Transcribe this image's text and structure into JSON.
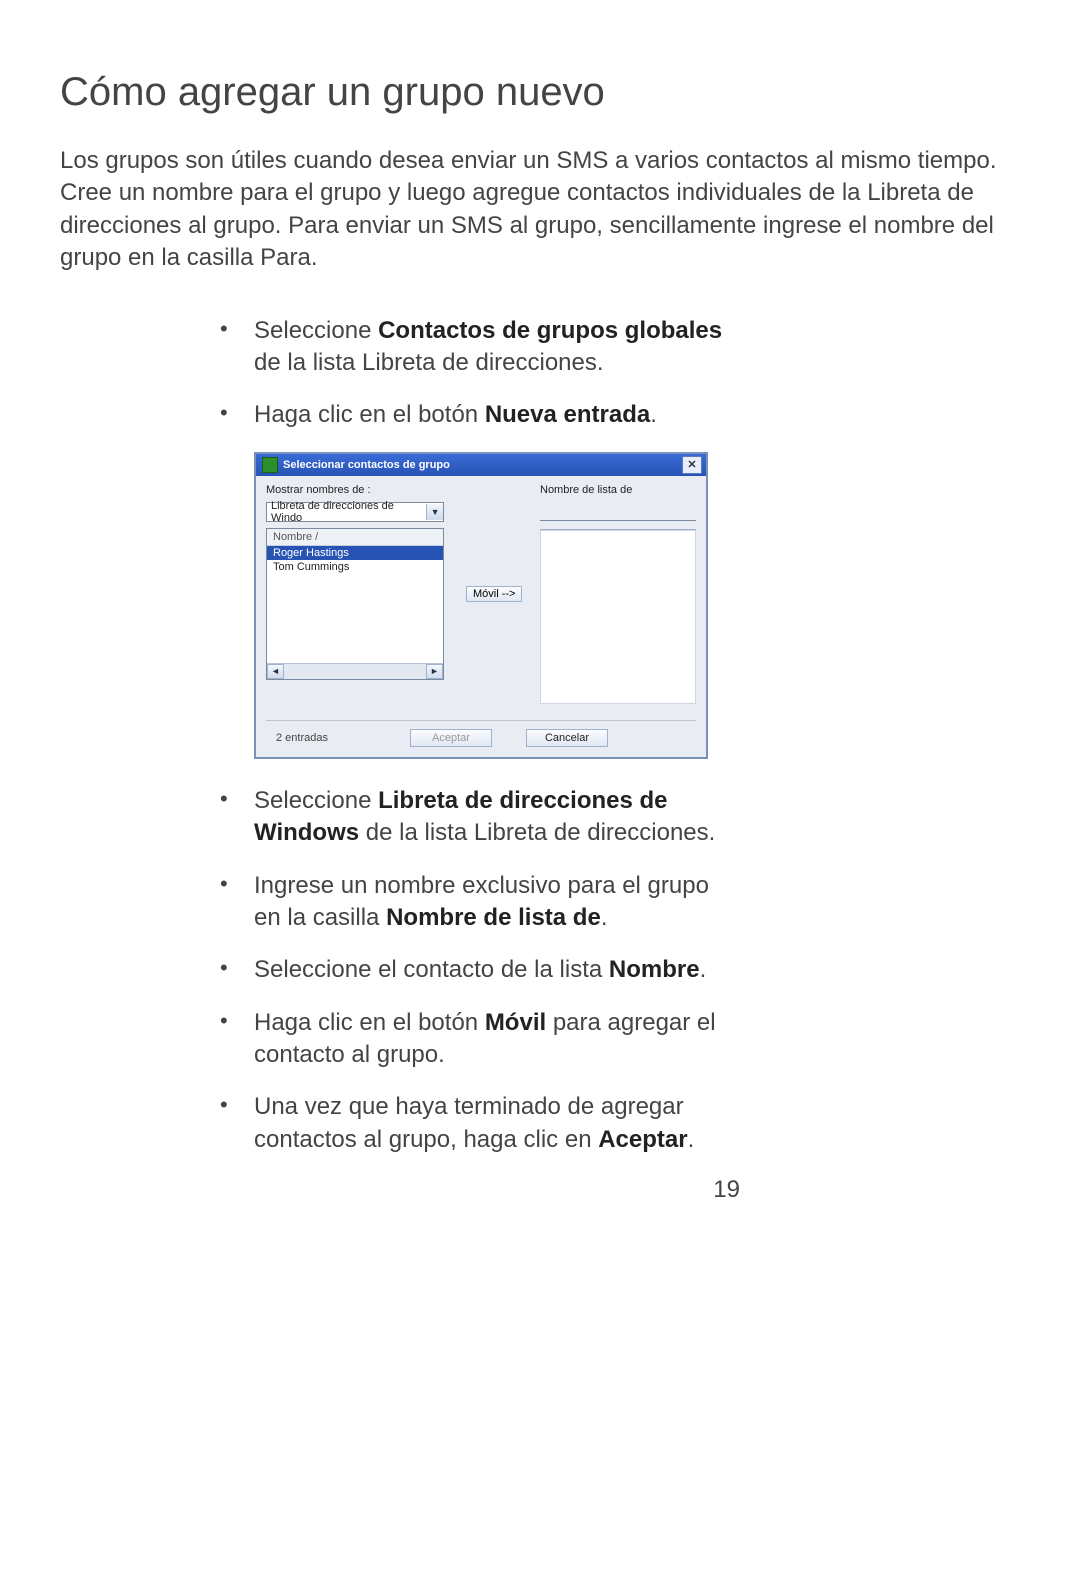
{
  "title": "Cómo agregar un grupo nuevo",
  "intro": "Los grupos son útiles cuando desea enviar un SMS a varios contactos al mismo tiempo. Cree un nombre para el grupo y luego agregue contactos individuales de la Libreta de direcciones al grupo. Para enviar un SMS al grupo, sencillamente ingrese el nombre del grupo en la casilla Para.",
  "bullets": {
    "b1a": "Seleccione ",
    "b1b": "Contactos de grupos globales",
    "b1c": " de la lista Libreta de direcciones.",
    "b2a": "Haga clic en el botón ",
    "b2b": "Nueva entrada",
    "b2c": ".",
    "b3a": "Seleccione ",
    "b3b": "Libreta de direcciones de Windows",
    "b3c": " de la lista Libreta de direcciones.",
    "b4a": "Ingrese un nombre exclusivo para el grupo en la casilla ",
    "b4b": "Nombre de lista de",
    "b4c": ".",
    "b5a": "Seleccione el contacto de la lista ",
    "b5b": "Nombre",
    "b5c": ".",
    "b6a": "Haga clic en el botón ",
    "b6b": "Móvil",
    "b6c": " para agregar el contacto al grupo.",
    "b7a": "Una vez que haya terminado de agregar contactos al grupo, haga clic en ",
    "b7b": "Aceptar",
    "b7c": "."
  },
  "dialog": {
    "title": "Seleccionar contactos de grupo",
    "close": "✕",
    "label_left": "Mostrar nombres de :",
    "dropdown": "Libreta de direcciones de Windo",
    "names_header": "Nombre  /",
    "names": [
      "Roger Hastings",
      "Tom Cummings"
    ],
    "move_btn": "Móvil -->",
    "label_right": "Nombre de lista de",
    "entries": "2 entradas",
    "ok": "Aceptar",
    "cancel": "Cancelar"
  },
  "page_number": "19"
}
